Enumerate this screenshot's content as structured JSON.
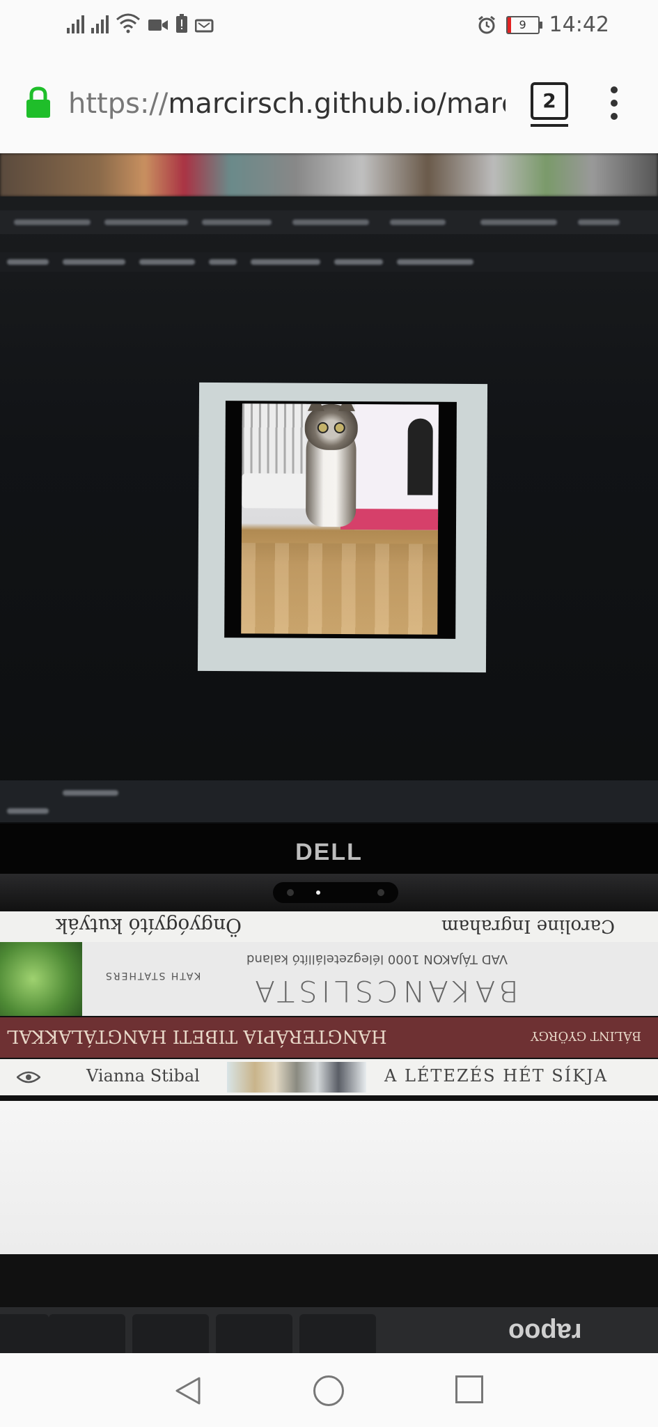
{
  "status_bar": {
    "time": "14:42",
    "battery_level": "9",
    "colors": {
      "battery_low": "#e22222"
    },
    "icons": [
      "signal-1-icon",
      "signal-2-icon",
      "wifi-icon",
      "video-call-icon",
      "battery-saver-icon",
      "notification-icon",
      "alarm-icon",
      "battery-icon"
    ]
  },
  "address_bar": {
    "protocol": "https://",
    "host": "marcirsch.github.io/marcir",
    "tab_count": "2",
    "colors": {
      "lock": "#1fbe2a"
    }
  },
  "camera_view": {
    "laptop_brand": "DELL",
    "keyboard_brand": "rapoo",
    "books": {
      "book1_author": "Caroline Ingraham",
      "book1_title": "Öngyógyító kutyák",
      "book2_title": "BAKANCSLISTA",
      "book2_subtitle": "VAD TÁJAKON 1000 lélegzetelállító kaland",
      "book2_author": "KATH STATHERS",
      "book3_author": "BÁLINT GYÖRGY",
      "book3_title": "HANGTERÁPIA TIBETI HANGTÁLAKKAL",
      "book4_author": "Vianna Stibal",
      "book4_title": "A LÉTEZÉS HÉT SÍKJA"
    }
  },
  "nav_bar": {
    "icons": [
      "back-icon",
      "home-icon",
      "recent-apps-icon"
    ]
  }
}
